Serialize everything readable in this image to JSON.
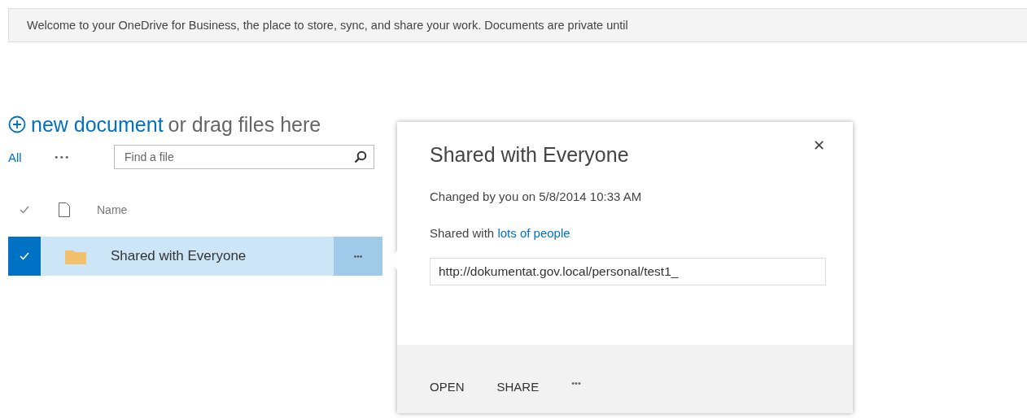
{
  "banner": {
    "text": "Welcome to your OneDrive for Business, the place to store, sync, and share your work. Documents are private until"
  },
  "new_document": {
    "link": "new document",
    "rest": "or drag files here"
  },
  "toolbar": {
    "view": "All",
    "more": "•••",
    "search": {
      "placeholder": "Find a file"
    }
  },
  "table": {
    "columns": [
      "Name"
    ],
    "rows": [
      {
        "name": "Shared with Everyone",
        "kind": "folder",
        "selected": true,
        "more": "•••"
      }
    ]
  },
  "callout": {
    "title": "Shared with Everyone",
    "close": "✕",
    "changed": "Changed by you on 5/8/2014 10:33 AM",
    "shared_prefix": "Shared with",
    "shared_link": "lots of people",
    "url": "http://dokumentat.gov.local/personal/test1_",
    "actions": [
      "OPEN",
      "SHARE",
      "•••"
    ]
  }
}
